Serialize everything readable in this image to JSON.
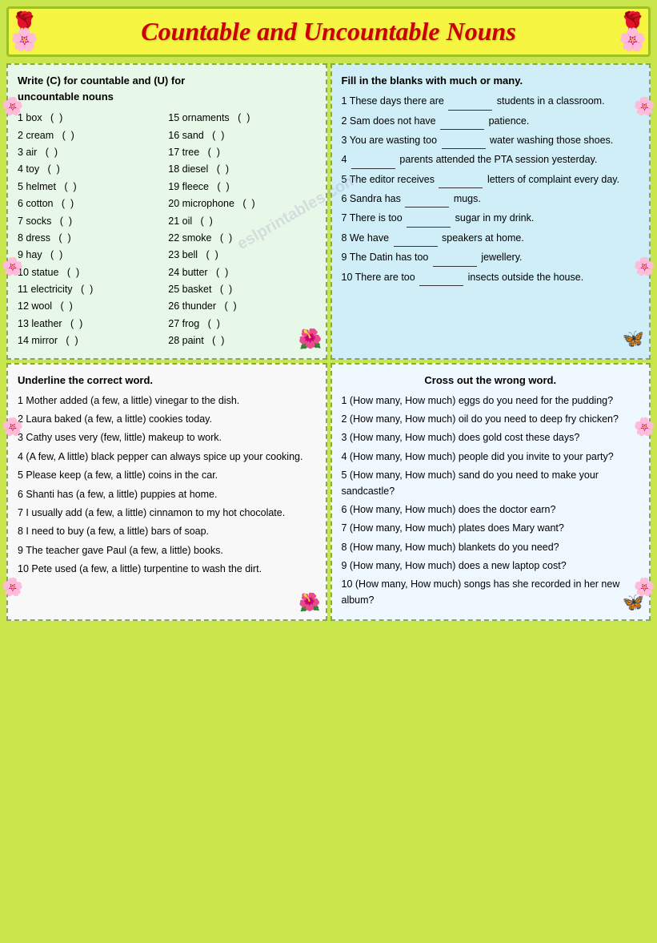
{
  "header": {
    "title": "Countable and Uncountable Nouns"
  },
  "section1": {
    "instruction": "Write (C) for countable and (U) for uncountable nouns",
    "items_left": [
      "1 box  ( )",
      "2 cream  ( )",
      "3 air  ( )",
      "4 toy  ( )",
      "5 helmet  ( )",
      "6 cotton  ( )",
      "7 socks  ( )",
      "8 dress  ( )",
      "9 hay  ( )",
      "10 statue  ( )",
      "11 electricity  ( )",
      "12 wool  ( )",
      "13 leather  ( )",
      "14 mirror  ( )"
    ],
    "items_right": [
      "15 ornaments  ( )",
      "16 sand  ( )",
      "17 tree  ( )",
      "18 diesel  ( )",
      "19 fleece  ( )",
      "20 microphone  ( )",
      "21 oil  ( )",
      "22 smoke  ( )",
      "23 bell  ( )",
      "24 butter  ( )",
      "25 basket  ( )",
      "26 thunder  ( )",
      "27 frog  ( )",
      "28 paint  ( )"
    ]
  },
  "section2": {
    "instruction": "Fill in the blanks with much or many.",
    "items": [
      "1 These days there are _______ students in a classroom.",
      "2 Sam does not have _______ patience.",
      "3 You are wasting too _______ water washing those shoes.",
      "4 _______ parents attended the PTA session yesterday.",
      "5 The editor receives _______ letters of complaint every day.",
      "6 Sandra has _______ mugs.",
      "7 There is too _______ sugar in my drink.",
      "8 We have _______ speakers at home.",
      "9 The Datin has too _______ jewellery.",
      "10 There are too _______ insects outside the house."
    ]
  },
  "section3": {
    "instruction": "Underline the correct word.",
    "items": [
      "1 Mother added (a few, a little) vinegar to the dish.",
      "2 Laura baked (a few, a little) cookies today.",
      "3 Cathy uses very (few, little) makeup to work.",
      "4 (A few, A little) black pepper can always spice up your cooking.",
      "5 Please keep (a few, a little) coins in the car.",
      "6 Shanti has (a few, a little) puppies at home.",
      "7 I usually add (a few, a little) cinnamon to my hot chocolate.",
      "8 I need to buy (a few, a little) bars of soap.",
      "9 The teacher gave Paul (a few, a little) books.",
      "10 Pete used (a few, a little) turpentine to wash the dirt."
    ]
  },
  "section4": {
    "instruction": "Cross out the wrong word.",
    "items": [
      "1 (How many, How much) eggs do you need for the pudding?",
      "2 (How many, How much) oil do you need to deep fry chicken?",
      "3 (How many, How much) does gold cost these days?",
      "4 (How many, How much) people did you invite to your party?",
      "5 (How many, How much) sand do you need to make your sandcastle?",
      "6 (How many, How much) does the doctor earn?",
      "7 (How many, How much) plates does Mary want?",
      "8 (How many, How much) blankets do you need?",
      "9 (How many, How much) does a new laptop cost?",
      "10 (How many, How much) songs has she recorded in her new album?"
    ]
  }
}
